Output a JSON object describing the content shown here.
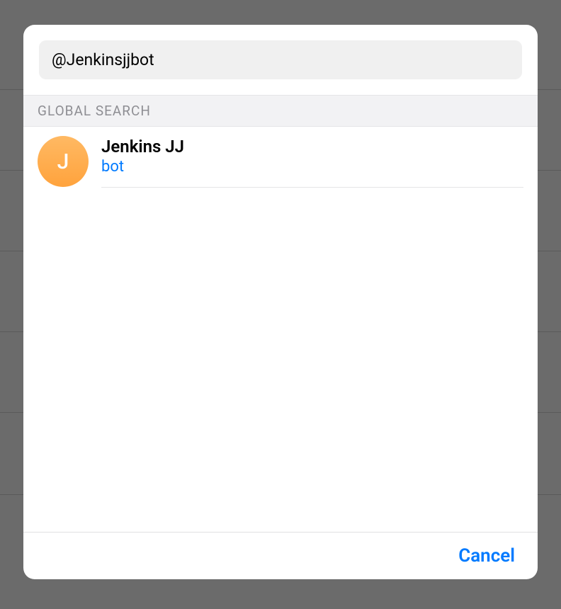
{
  "search": {
    "value": "@Jenkinsjjbot"
  },
  "section": {
    "header": "GLOBAL SEARCH"
  },
  "results": [
    {
      "avatar_letter": "J",
      "name": "Jenkins JJ",
      "subtitle": "bot"
    }
  ],
  "footer": {
    "cancel_label": "Cancel"
  },
  "background_line_positions": [
    126,
    240,
    354,
    468,
    582,
    698
  ]
}
